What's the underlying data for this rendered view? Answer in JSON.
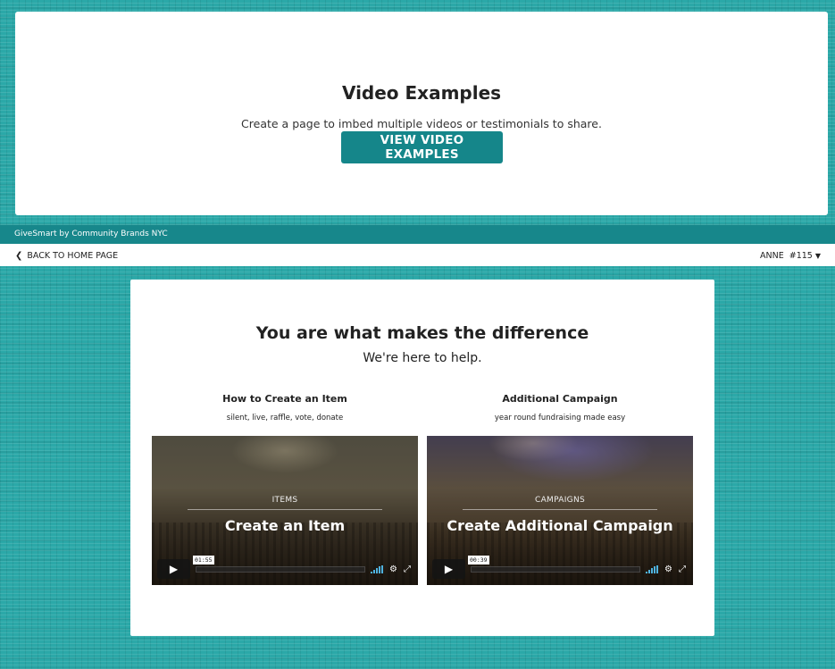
{
  "colors": {
    "accent": "#15868a",
    "background": "#2ba8a8"
  },
  "top_section": {
    "title": "Video Examples",
    "subtitle": "Create a page to imbed multiple videos or testimonials to share.",
    "button_label": "VIEW VIDEO EXAMPLES"
  },
  "footer": {
    "text": "GiveSmart by Community Brands NYC"
  },
  "nav": {
    "back_label": "BACK TO HOME PAGE",
    "user_name": "ANNE",
    "user_number": "#115"
  },
  "main": {
    "title": "You are what makes the difference",
    "subtitle": "We're here to help.",
    "columns": [
      {
        "heading": "How to Create an Item",
        "description": "silent, live, raffle, vote, donate",
        "video": {
          "kicker": "ITEMS",
          "title": "Create an Item",
          "timecode": "01:55"
        }
      },
      {
        "heading": "Additional Campaign",
        "description": "year round fundraising made easy",
        "video": {
          "kicker": "CAMPAIGNS",
          "title": "Create Additional Campaign",
          "timecode": "00:39"
        }
      }
    ]
  },
  "icons": [
    "chevron-left-icon",
    "caret-down-icon",
    "play-icon",
    "volume-icon",
    "settings-icon",
    "fullscreen-icon"
  ]
}
